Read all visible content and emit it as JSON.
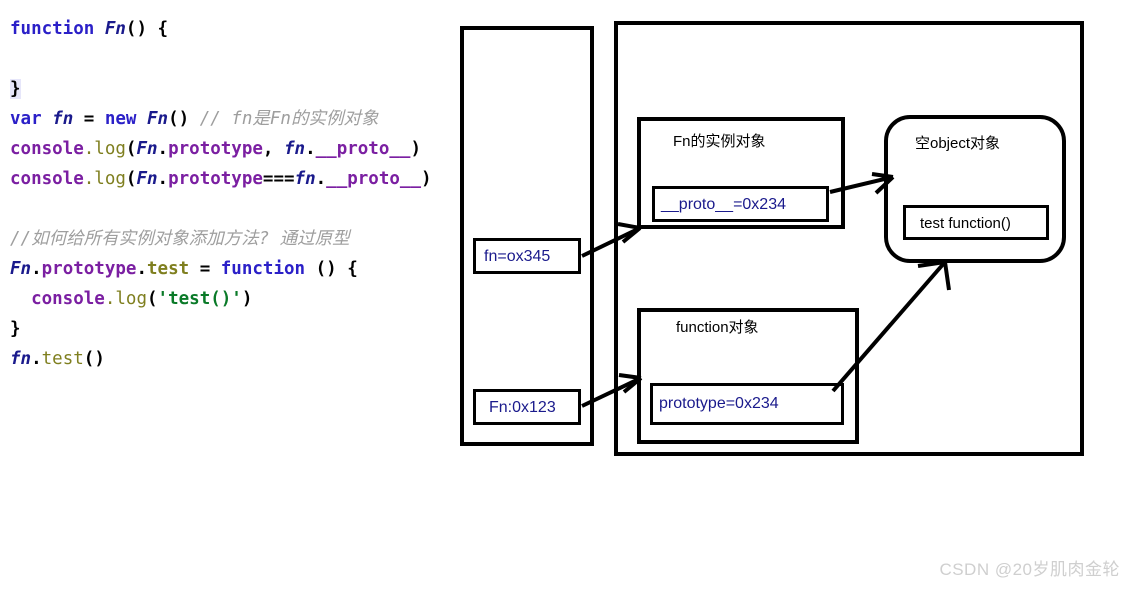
{
  "code": {
    "lines": [
      [
        {
          "t": "function ",
          "c": "kw"
        },
        {
          "t": "Fn",
          "c": "fnname"
        },
        {
          "t": "() {",
          "c": "punct"
        }
      ],
      [],
      [
        {
          "t": "}",
          "c": "brace"
        }
      ],
      [
        {
          "t": "var ",
          "c": "kw"
        },
        {
          "t": "fn",
          "c": "fnname"
        },
        {
          "t": " = ",
          "c": "op"
        },
        {
          "t": "new ",
          "c": "kw"
        },
        {
          "t": "Fn",
          "c": "fnname"
        },
        {
          "t": "() ",
          "c": "punct"
        },
        {
          "t": "// fn是Fn的实例对象",
          "c": "comment"
        }
      ],
      [
        {
          "t": "console",
          "c": "ident"
        },
        {
          "t": ".log",
          "c": "method"
        },
        {
          "t": "(",
          "c": "punct"
        },
        {
          "t": "Fn",
          "c": "fnname"
        },
        {
          "t": ".",
          "c": "punct"
        },
        {
          "t": "prototype",
          "c": "prop"
        },
        {
          "t": ", ",
          "c": "punct"
        },
        {
          "t": "fn",
          "c": "fnname"
        },
        {
          "t": ".",
          "c": "punct"
        },
        {
          "t": "__proto__",
          "c": "proto"
        },
        {
          "t": ")",
          "c": "punct"
        }
      ],
      [
        {
          "t": "console",
          "c": "ident"
        },
        {
          "t": ".log",
          "c": "method"
        },
        {
          "t": "(",
          "c": "punct"
        },
        {
          "t": "Fn",
          "c": "fnname"
        },
        {
          "t": ".",
          "c": "punct"
        },
        {
          "t": "prototype",
          "c": "prop"
        },
        {
          "t": "===",
          "c": "op"
        },
        {
          "t": "fn",
          "c": "fnname"
        },
        {
          "t": ".",
          "c": "punct"
        },
        {
          "t": "__proto__",
          "c": "proto"
        },
        {
          "t": ")",
          "c": "punct"
        }
      ],
      [],
      [
        {
          "t": "//如何给所有实例对象添加方法? 通过原型",
          "c": "comment"
        }
      ],
      [
        {
          "t": "Fn",
          "c": "fnname"
        },
        {
          "t": ".",
          "c": "punct"
        },
        {
          "t": "prototype",
          "c": "prop"
        },
        {
          "t": ".",
          "c": "punct"
        },
        {
          "t": "test",
          "c": "testid"
        },
        {
          "t": " = ",
          "c": "op"
        },
        {
          "t": "function ",
          "c": "kw"
        },
        {
          "t": "() {",
          "c": "punct"
        }
      ],
      [
        {
          "t": "  ",
          "c": "plain"
        },
        {
          "t": "console",
          "c": "ident"
        },
        {
          "t": ".log",
          "c": "method"
        },
        {
          "t": "(",
          "c": "punct"
        },
        {
          "t": "'test()'",
          "c": "str"
        },
        {
          "t": ")",
          "c": "punct"
        }
      ],
      [
        {
          "t": "}",
          "c": "brace-plain"
        }
      ],
      [
        {
          "t": "fn",
          "c": "fnname"
        },
        {
          "t": ".",
          "c": "punct"
        },
        {
          "t": "test",
          "c": "method"
        },
        {
          "t": "()",
          "c": "punct"
        }
      ]
    ]
  },
  "diagram": {
    "stack_container_label": "",
    "heap_container_label": "",
    "boxes": {
      "fn_var": "fn=ox345",
      "Fn_var": "Fn:0x123",
      "instance_title": "Fn的实例对象",
      "instance_slot": "__proto__=0x234",
      "empty_object_title": "空object对象",
      "empty_object_slot": "test function()",
      "function_object_title": "function对象",
      "function_object_slot": "prototype=0x234"
    }
  },
  "watermark": "CSDN @20岁肌肉金轮",
  "colors": {
    "stroke": "#000000",
    "memory_text": "#1a1a8c",
    "watermark": "#cfcfcf"
  }
}
